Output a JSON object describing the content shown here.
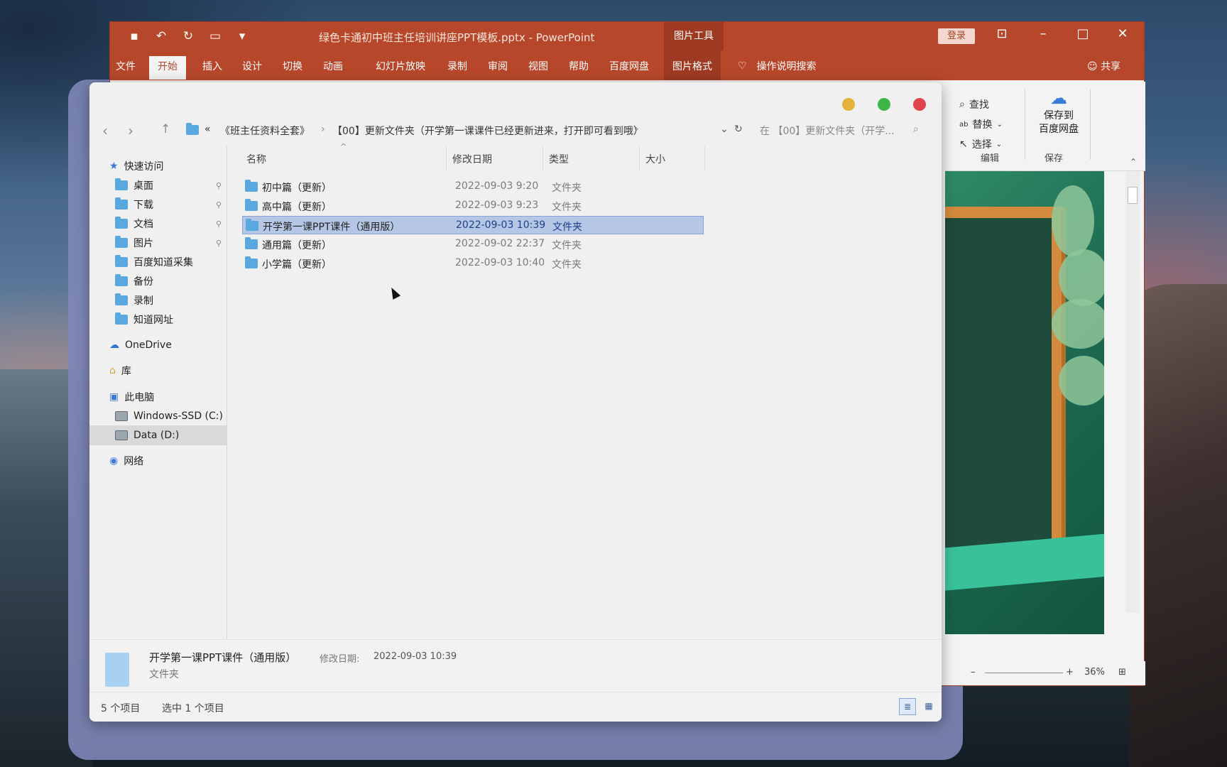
{
  "ppt": {
    "title": "绿色卡通初中班主任培训讲座PPT模板.pptx  -  PowerPoint",
    "picture_tools": "图片工具",
    "login": "登录",
    "tabs": [
      "文件",
      "开始",
      "插入",
      "设计",
      "切换",
      "动画",
      "幻灯片放映",
      "录制",
      "审阅",
      "视图",
      "帮助",
      "百度网盘",
      "图片格式"
    ],
    "tell_me": "操作说明搜索",
    "share": "共享",
    "ribbon": {
      "find": "查找",
      "replace": "替换",
      "select": "选择",
      "edit_group": "编辑",
      "save_to_line1": "保存到",
      "save_to_line2": "百度网盘",
      "save_group": "保存"
    },
    "zoom": "36%"
  },
  "explorer": {
    "breadcrumb": [
      "«",
      "《班主任资料全套》",
      "【00】更新文件夹（开学第一课课件已经更新进来，打开即可看到哦）"
    ],
    "search_placeholder": "在 【00】更新文件夹（开学...",
    "sidebar": {
      "quick_access": "快速访问",
      "items": [
        "桌面",
        "下载",
        "文档",
        "图片",
        "百度知道采集",
        "备份",
        "录制",
        "知道网址"
      ],
      "onedrive": "OneDrive",
      "library": "库",
      "this_pc": "此电脑",
      "drives": [
        "Windows-SSD (C:)",
        "Data (D:)"
      ],
      "network": "网络"
    },
    "columns": [
      "名称",
      "修改日期",
      "类型",
      "大小"
    ],
    "rows": [
      {
        "name": "初中篇（更新）",
        "date": "2022-09-03 9:20",
        "type": "文件夹"
      },
      {
        "name": "高中篇（更新）",
        "date": "2022-09-03 9:23",
        "type": "文件夹"
      },
      {
        "name": "开学第一课PPT课件（通用版）",
        "date": "2022-09-03 10:39",
        "type": "文件夹"
      },
      {
        "name": "通用篇（更新）",
        "date": "2022-09-02 22:37",
        "type": "文件夹"
      },
      {
        "name": "小学篇（更新）",
        "date": "2022-09-03 10:40",
        "type": "文件夹"
      }
    ],
    "details": {
      "name": "开学第一课PPT课件（通用版）",
      "modified_label": "修改日期:",
      "modified_value": "2022-09-03 10:39",
      "type": "文件夹"
    },
    "status": {
      "count": "5 个项目",
      "selected": "选中 1 个项目"
    }
  }
}
